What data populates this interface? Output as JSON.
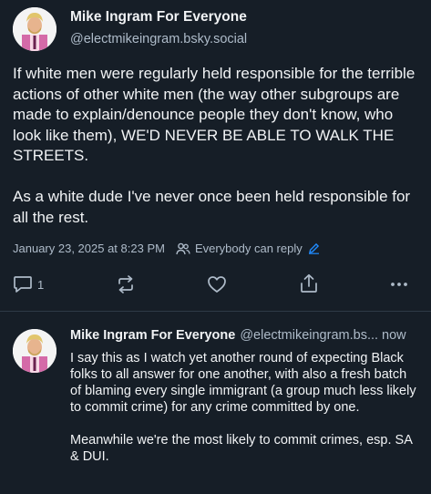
{
  "post": {
    "author_name": "Mike Ingram For Everyone",
    "author_handle": "@electmikeingram.bsky.social",
    "text": "If white men were regularly held responsible for the terrible actions of other white men (the way other subgroups are made to explain/denounce people they don't know, who look like them), WE'D NEVER BE ABLE TO WALK THE STREETS.\n\nAs a white dude I've never once been held responsible for all the rest.",
    "timestamp": "January 23, 2025 at 8:23 PM",
    "reply_setting": "Everybody can reply",
    "reply_count": "1"
  },
  "reply": {
    "author_name": "Mike Ingram For Everyone",
    "author_handle": "@electmikeingram.bs...",
    "time": "now",
    "text": "I say this as I watch yet another round of expecting Black folks to all answer for one another, with also a fresh batch of blaming every single immigrant (a group much less likely to commit crime) for any crime committed by one.\n\nMeanwhile we're the most likely to commit crimes, esp. SA & DUI."
  },
  "icons": {
    "reply": "reply-bubble-icon",
    "repost": "repost-icon",
    "like": "heart-icon",
    "share": "share-icon",
    "more": "more-dots-icon",
    "people": "people-icon",
    "edit": "pencil-icon"
  },
  "colors": {
    "background": "#161e27",
    "text": "#f1f3f5",
    "muted": "#aebbc9",
    "accent": "#208bfe"
  }
}
